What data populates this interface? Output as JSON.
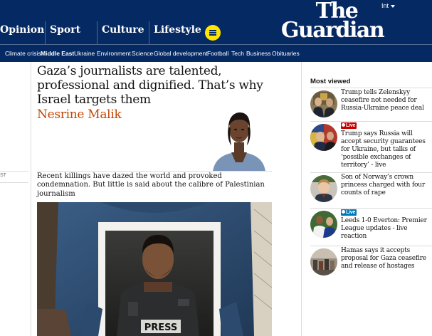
{
  "header": {
    "pillars": [
      "Opinion",
      "Sport",
      "Culture",
      "Lifestyle"
    ],
    "edition": "Int",
    "logo_line1": "The",
    "logo_line2": "Guardian"
  },
  "subnav": [
    "Climate crisis",
    "Middle East",
    "Ukraine",
    "Environment",
    "Science",
    "Global development",
    "Football",
    "Tech",
    "Business",
    "Obituaries"
  ],
  "subnav_active": "Middle East",
  "left_column_stub": "ST",
  "article": {
    "headline_lines": [
      "Gaza’s journalists are talented,",
      "professional and dignified. That’s why",
      "Israel targets them"
    ],
    "byline": "Nesrine Malik",
    "standfirst_lines": [
      "Recent killings have dazed the world and provoked",
      "condemnation. But little is said about the calibre of Palestinian",
      "journalism"
    ],
    "image_sign_text": "PRESS"
  },
  "most_viewed": {
    "title": "Most viewed",
    "items": [
      {
        "lines": [
          "Trump tells Zelenskyy",
          "ceasefire not needed for",
          "Russia-Ukraine peace deal"
        ],
        "live": false
      },
      {
        "lines": [
          "Trump says Russia will",
          "accept security guarantees",
          "for Ukraine, but talks of",
          "‘possible exchanges of",
          "territory’ - live"
        ],
        "live": true,
        "live_label": "Live",
        "live_color": "red"
      },
      {
        "lines": [
          "Son of Norway’s crown",
          "princess charged with four",
          "counts of rape"
        ],
        "live": false
      },
      {
        "lines": [
          "Leeds 1-0 Everton: Premier",
          "League updates - live",
          "reaction"
        ],
        "live": true,
        "live_label": "Live",
        "live_color": "blue"
      },
      {
        "lines": [
          "Hamas says it accepts",
          "proposal for Gaza ceasefire",
          "and release of hostages"
        ],
        "live": false
      }
    ]
  },
  "colors": {
    "brand_blue": "#052962",
    "opinion_orange": "#c74600",
    "menu_yellow": "#ffe500",
    "live_red": "#c70000"
  }
}
